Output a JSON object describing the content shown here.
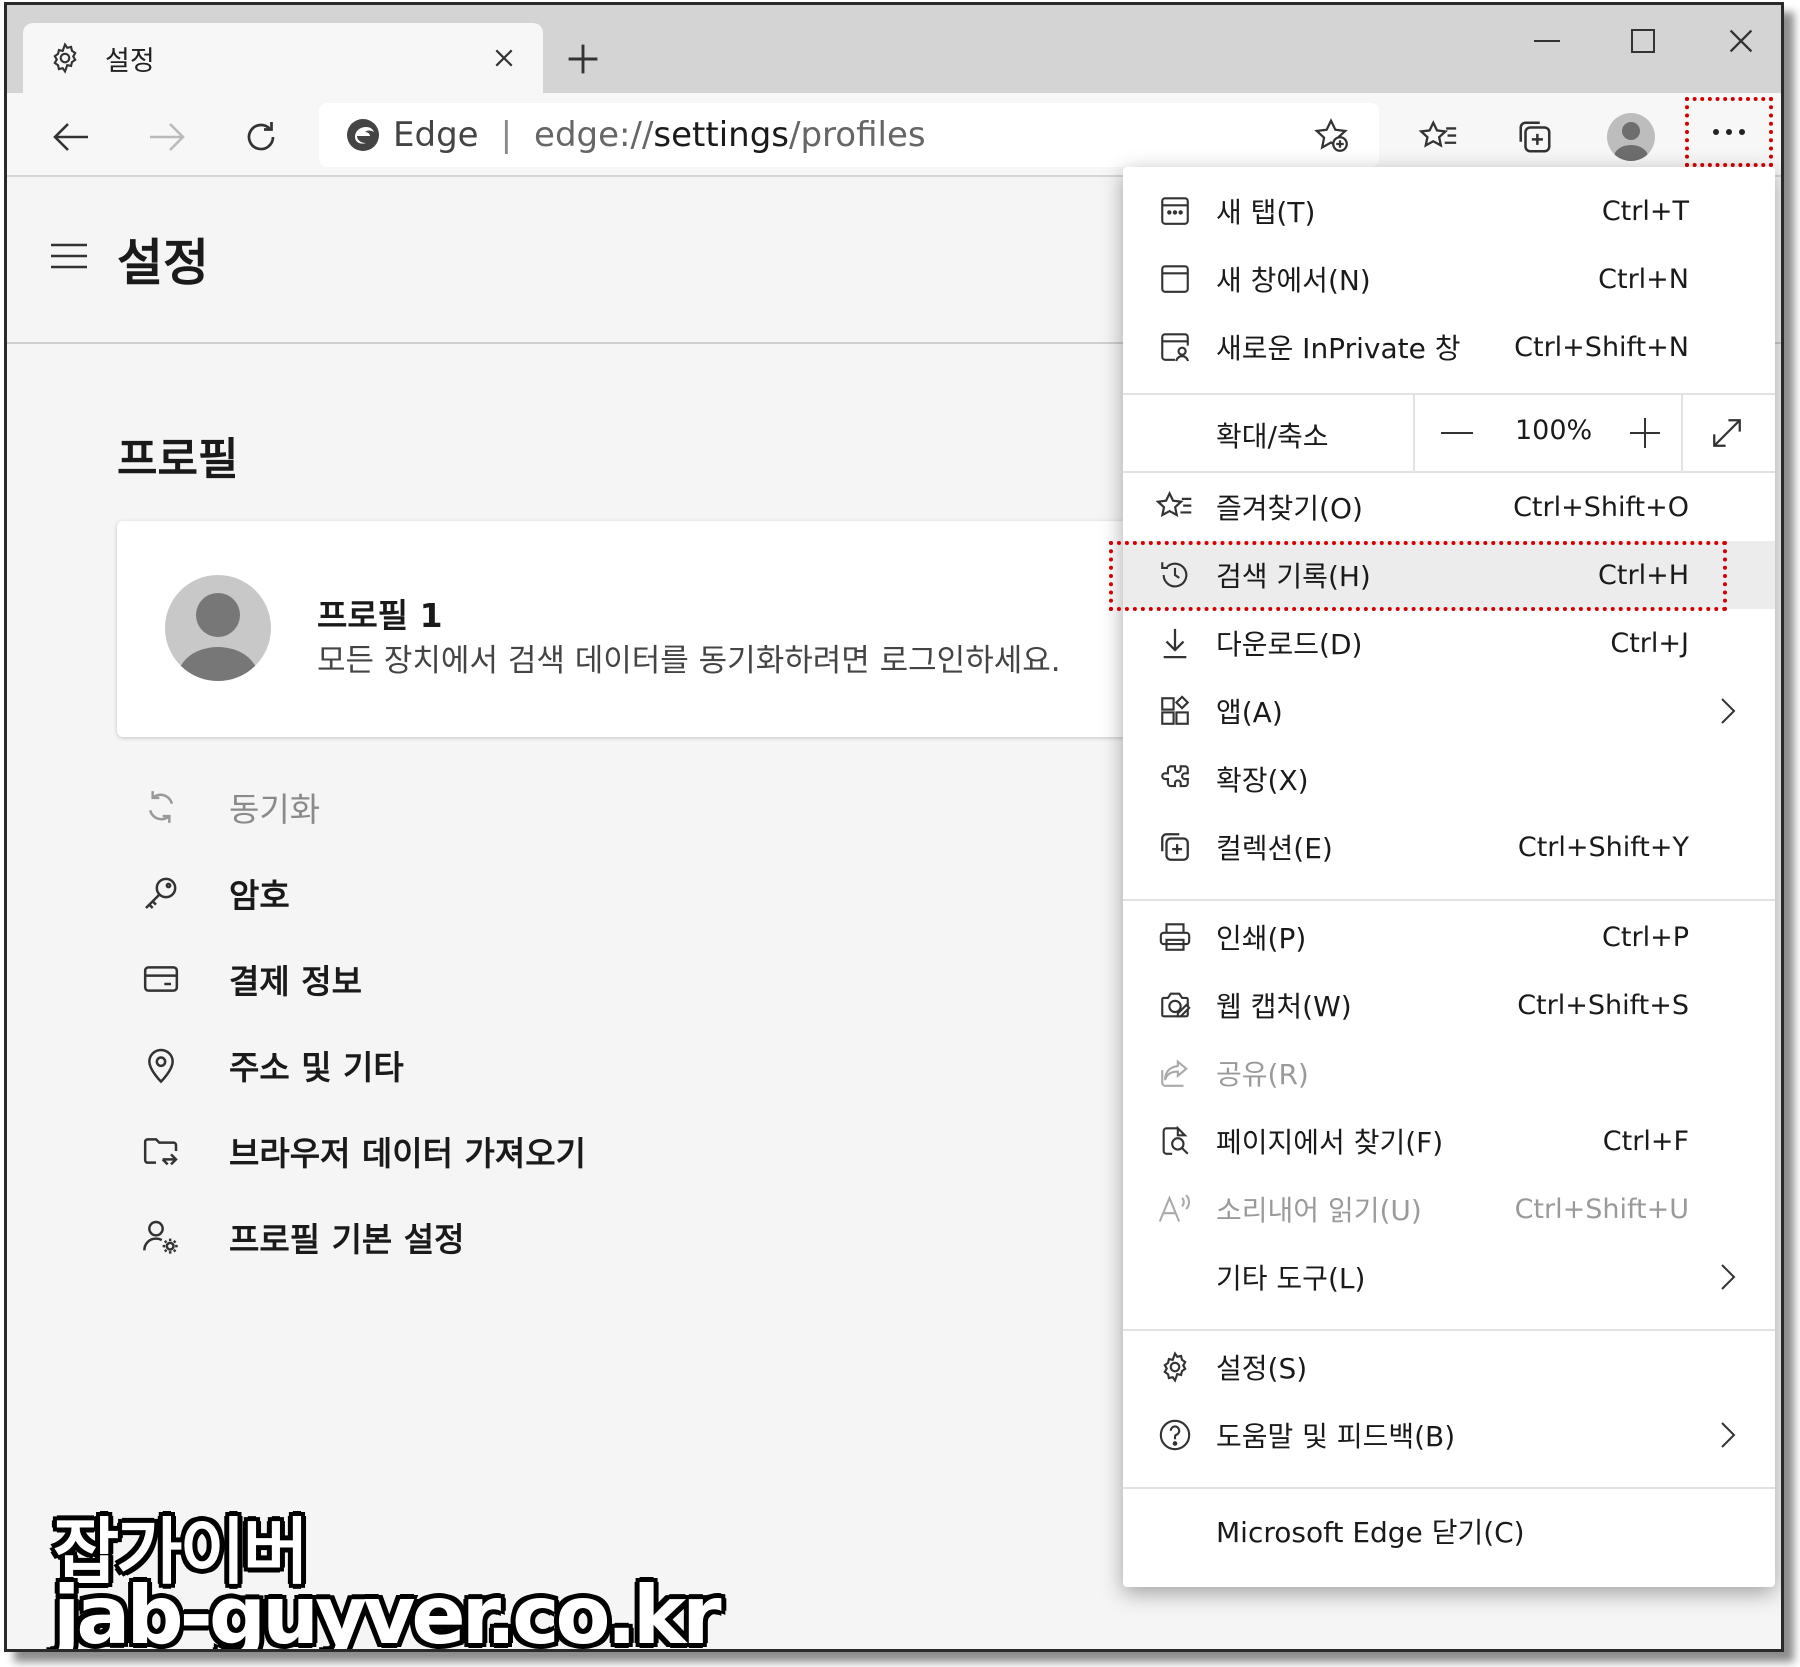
{
  "tab": {
    "title": "설정",
    "icon": "gear-icon",
    "close_icon": "close-icon"
  },
  "newtab_icon": "plus-icon",
  "window_controls": [
    "minimize-icon",
    "maximize-icon",
    "close-icon"
  ],
  "address": {
    "brand": "Edge",
    "separator": "|",
    "url_prefix": "edge://",
    "url_main": "settings",
    "url_suffix": "/profiles"
  },
  "page": {
    "title": "설정",
    "section": "프로필",
    "profile": {
      "name": "프로필 1",
      "description": "모든 장치에서 검색 데이터를 동기화하려면 로그인하세요."
    },
    "nav_items": [
      {
        "label": "동기화",
        "icon": "sync-icon",
        "disabled": true
      },
      {
        "label": "암호",
        "icon": "key-icon"
      },
      {
        "label": "결제 정보",
        "icon": "credit-card-icon"
      },
      {
        "label": "주소 및 기타",
        "icon": "location-pin-icon"
      },
      {
        "label": "브라우저 데이터 가져오기",
        "icon": "import-folder-icon"
      },
      {
        "label": "프로필 기본 설정",
        "icon": "profile-settings-icon"
      }
    ]
  },
  "menu": {
    "items": [
      {
        "label": "새 탭(T)",
        "shortcut": "Ctrl+T",
        "icon": "new-tab-icon"
      },
      {
        "label": "새 창에서(N)",
        "shortcut": "Ctrl+N",
        "icon": "new-window-icon"
      },
      {
        "label": "새로운 InPrivate 창",
        "shortcut": "Ctrl+Shift+N",
        "icon": "inprivate-icon"
      },
      {
        "label": "즐겨찾기(O)",
        "shortcut": "Ctrl+Shift+O",
        "icon": "favorites-icon"
      },
      {
        "label": "검색 기록(H)",
        "shortcut": "Ctrl+H",
        "icon": "history-icon"
      },
      {
        "label": "다운로드(D)",
        "shortcut": "Ctrl+J",
        "icon": "download-icon"
      },
      {
        "label": "앱(A)",
        "shortcut": "",
        "icon": "apps-icon"
      },
      {
        "label": "확장(X)",
        "shortcut": "",
        "icon": "extensions-icon"
      },
      {
        "label": "컬렉션(E)",
        "shortcut": "Ctrl+Shift+Y",
        "icon": "collections-icon"
      },
      {
        "label": "인쇄(P)",
        "shortcut": "Ctrl+P",
        "icon": "print-icon"
      },
      {
        "label": "웹 캡처(W)",
        "shortcut": "Ctrl+Shift+S",
        "icon": "web-capture-icon"
      },
      {
        "label": "공유(R)",
        "shortcut": "",
        "icon": "share-icon"
      },
      {
        "label": "페이지에서 찾기(F)",
        "shortcut": "Ctrl+F",
        "icon": "find-in-page-icon"
      },
      {
        "label": "소리내어 읽기(U)",
        "shortcut": "Ctrl+Shift+U",
        "icon": "read-aloud-icon"
      },
      {
        "label": "기타 도구(L)",
        "shortcut": "",
        "icon": ""
      },
      {
        "label": "설정(S)",
        "shortcut": "",
        "icon": "gear-icon"
      },
      {
        "label": "도움말 및 피드백(B)",
        "shortcut": "",
        "icon": "help-icon"
      },
      {
        "label": "Microsoft Edge 닫기(C)",
        "shortcut": "",
        "icon": ""
      }
    ],
    "zoom": {
      "label": "확대/축소",
      "value": "100%"
    }
  },
  "watermark": {
    "line1": "잡가이버",
    "line2": "jab-guyver.co.kr"
  },
  "colors": {
    "highlight": "#d40000",
    "titlebar": "#d4d4d4",
    "page_bg": "#f5f5f5"
  }
}
